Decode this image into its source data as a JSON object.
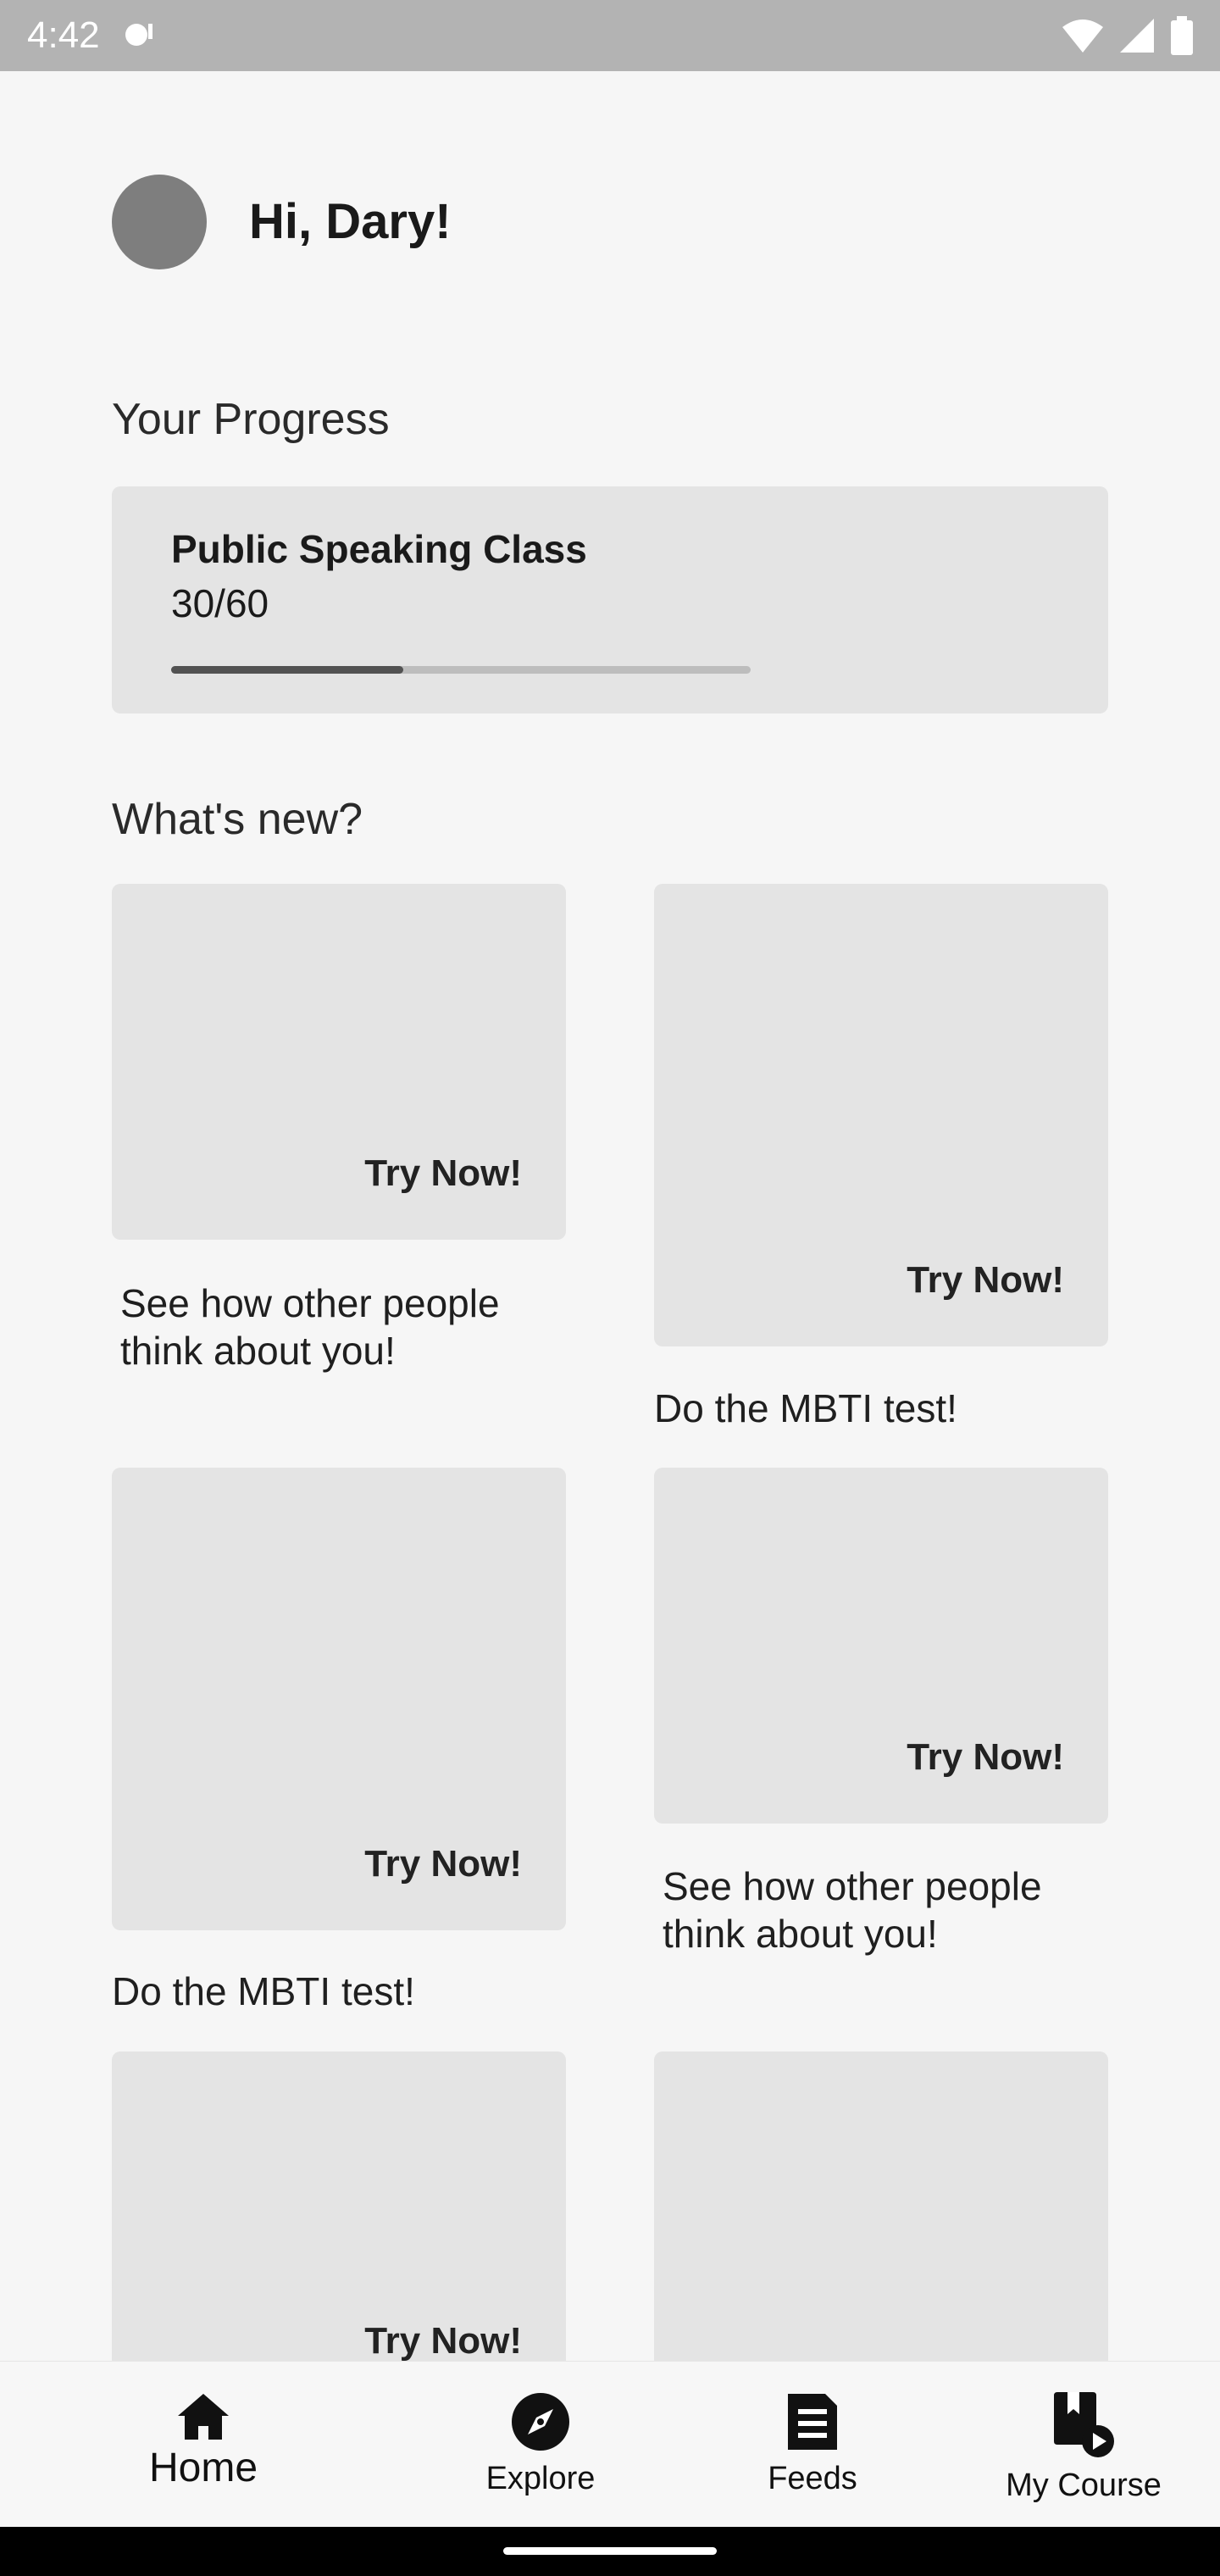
{
  "status_bar": {
    "time": "4:42"
  },
  "header": {
    "greeting": "Hi, Dary!"
  },
  "progress_section": {
    "title": "Your Progress",
    "course": {
      "name": "Public Speaking Class",
      "count_label": "30/60",
      "progress": 0.4
    }
  },
  "whats_new": {
    "title": "What's new?",
    "cards": [
      {
        "cta": "Try Now!",
        "caption": "See how other people think about you!"
      },
      {
        "cta": "Try Now!",
        "caption": "Do the MBTI test!"
      },
      {
        "cta": "Try Now!",
        "caption": "Do the MBTI test!"
      },
      {
        "cta": "Try Now!",
        "caption": "See how other people think about you!"
      },
      {
        "cta": "Try Now!",
        "caption": ""
      },
      {
        "cta": "",
        "caption": ""
      }
    ]
  },
  "bottom_nav": {
    "items": [
      {
        "label": "Home",
        "icon": "home-icon",
        "active": true
      },
      {
        "label": "Explore",
        "icon": "compass-icon",
        "active": false
      },
      {
        "label": "Feeds",
        "icon": "feed-icon",
        "active": false
      },
      {
        "label": "My Course",
        "icon": "course-play-icon",
        "active": false
      }
    ]
  },
  "colors": {
    "accent": "#525252",
    "tile": "#e4e4e4",
    "avatar": "#7e7e7e"
  }
}
